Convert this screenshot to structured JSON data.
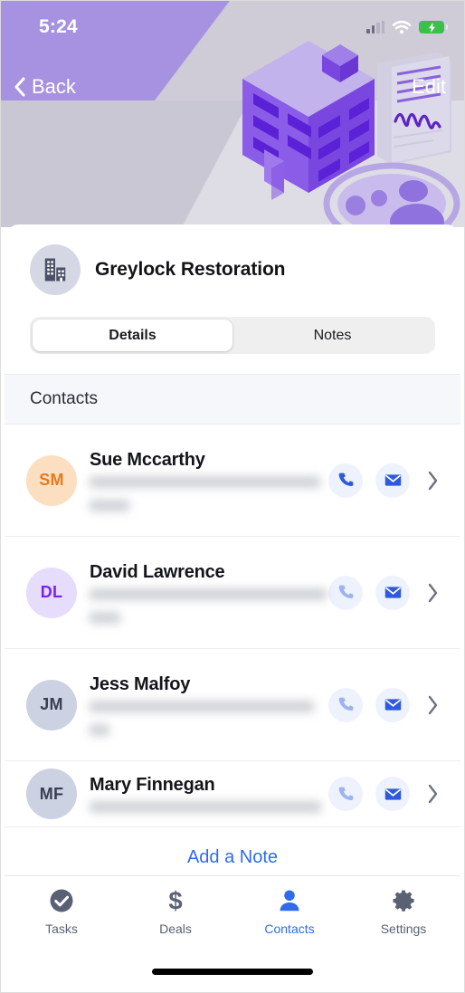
{
  "status_bar": {
    "time": "5:24",
    "signal_icon": "signal-bars-icon",
    "wifi_icon": "wifi-icon",
    "battery_icon": "battery-charging-icon",
    "battery_color": "#3ac14a"
  },
  "nav": {
    "back_label": "Back",
    "back_icon": "chevron-left-icon",
    "edit_label": "Edit"
  },
  "hero": {
    "building_illustration": "isometric-building-illustration",
    "document_illustration": "signed-document-illustration",
    "people_illustration": "people-group-illustration",
    "accent_purple": "#7c4ddb",
    "wedge_purple": "#a692e0"
  },
  "org": {
    "name": "Greylock Restoration",
    "icon": "building-icon"
  },
  "tabs_segment": {
    "items": [
      {
        "label": "Details",
        "active": true
      },
      {
        "label": "Notes",
        "active": false
      }
    ]
  },
  "section": {
    "title": "Contacts"
  },
  "contacts": [
    {
      "initials": "SM",
      "name": "Sue Mccarthy",
      "avatar_bg": "#fbdfc0",
      "avatar_fg": "#e8791f",
      "detail_redacted": true,
      "detail_lines": 2,
      "phone_icon": "phone-icon",
      "email_icon": "envelope-icon",
      "chevron_icon": "chevron-right-icon"
    },
    {
      "initials": "DL",
      "name": "David Lawrence",
      "avatar_bg": "#e6dcfb",
      "avatar_fg": "#7722ee",
      "detail_redacted": true,
      "detail_lines": 2,
      "phone_icon": "phone-icon",
      "email_icon": "envelope-icon",
      "chevron_icon": "chevron-right-icon"
    },
    {
      "initials": "JM",
      "name": "Jess Malfoy",
      "avatar_bg": "#ccd2e2",
      "avatar_fg": "#3a3f52",
      "detail_redacted": true,
      "detail_lines": 2,
      "phone_icon": "phone-icon",
      "email_icon": "envelope-icon",
      "chevron_icon": "chevron-right-icon"
    },
    {
      "initials": "MF",
      "name": "Mary Finnegan",
      "avatar_bg": "#ccd2e2",
      "avatar_fg": "#3a3f52",
      "detail_redacted": true,
      "detail_lines": 1,
      "phone_icon": "phone-icon",
      "email_icon": "envelope-icon",
      "chevron_icon": "chevron-right-icon"
    }
  ],
  "add_note": {
    "label": "Add a Note",
    "color": "#2f6bed"
  },
  "tabbar": {
    "active_color": "#2f6bed",
    "inactive_color": "#5b6174",
    "items": [
      {
        "label": "Tasks",
        "icon": "check-circle-icon",
        "active": false
      },
      {
        "label": "Deals",
        "icon": "dollar-icon",
        "active": false
      },
      {
        "label": "Contacts",
        "icon": "person-icon",
        "active": true
      },
      {
        "label": "Settings",
        "icon": "gear-icon",
        "active": false
      }
    ]
  }
}
